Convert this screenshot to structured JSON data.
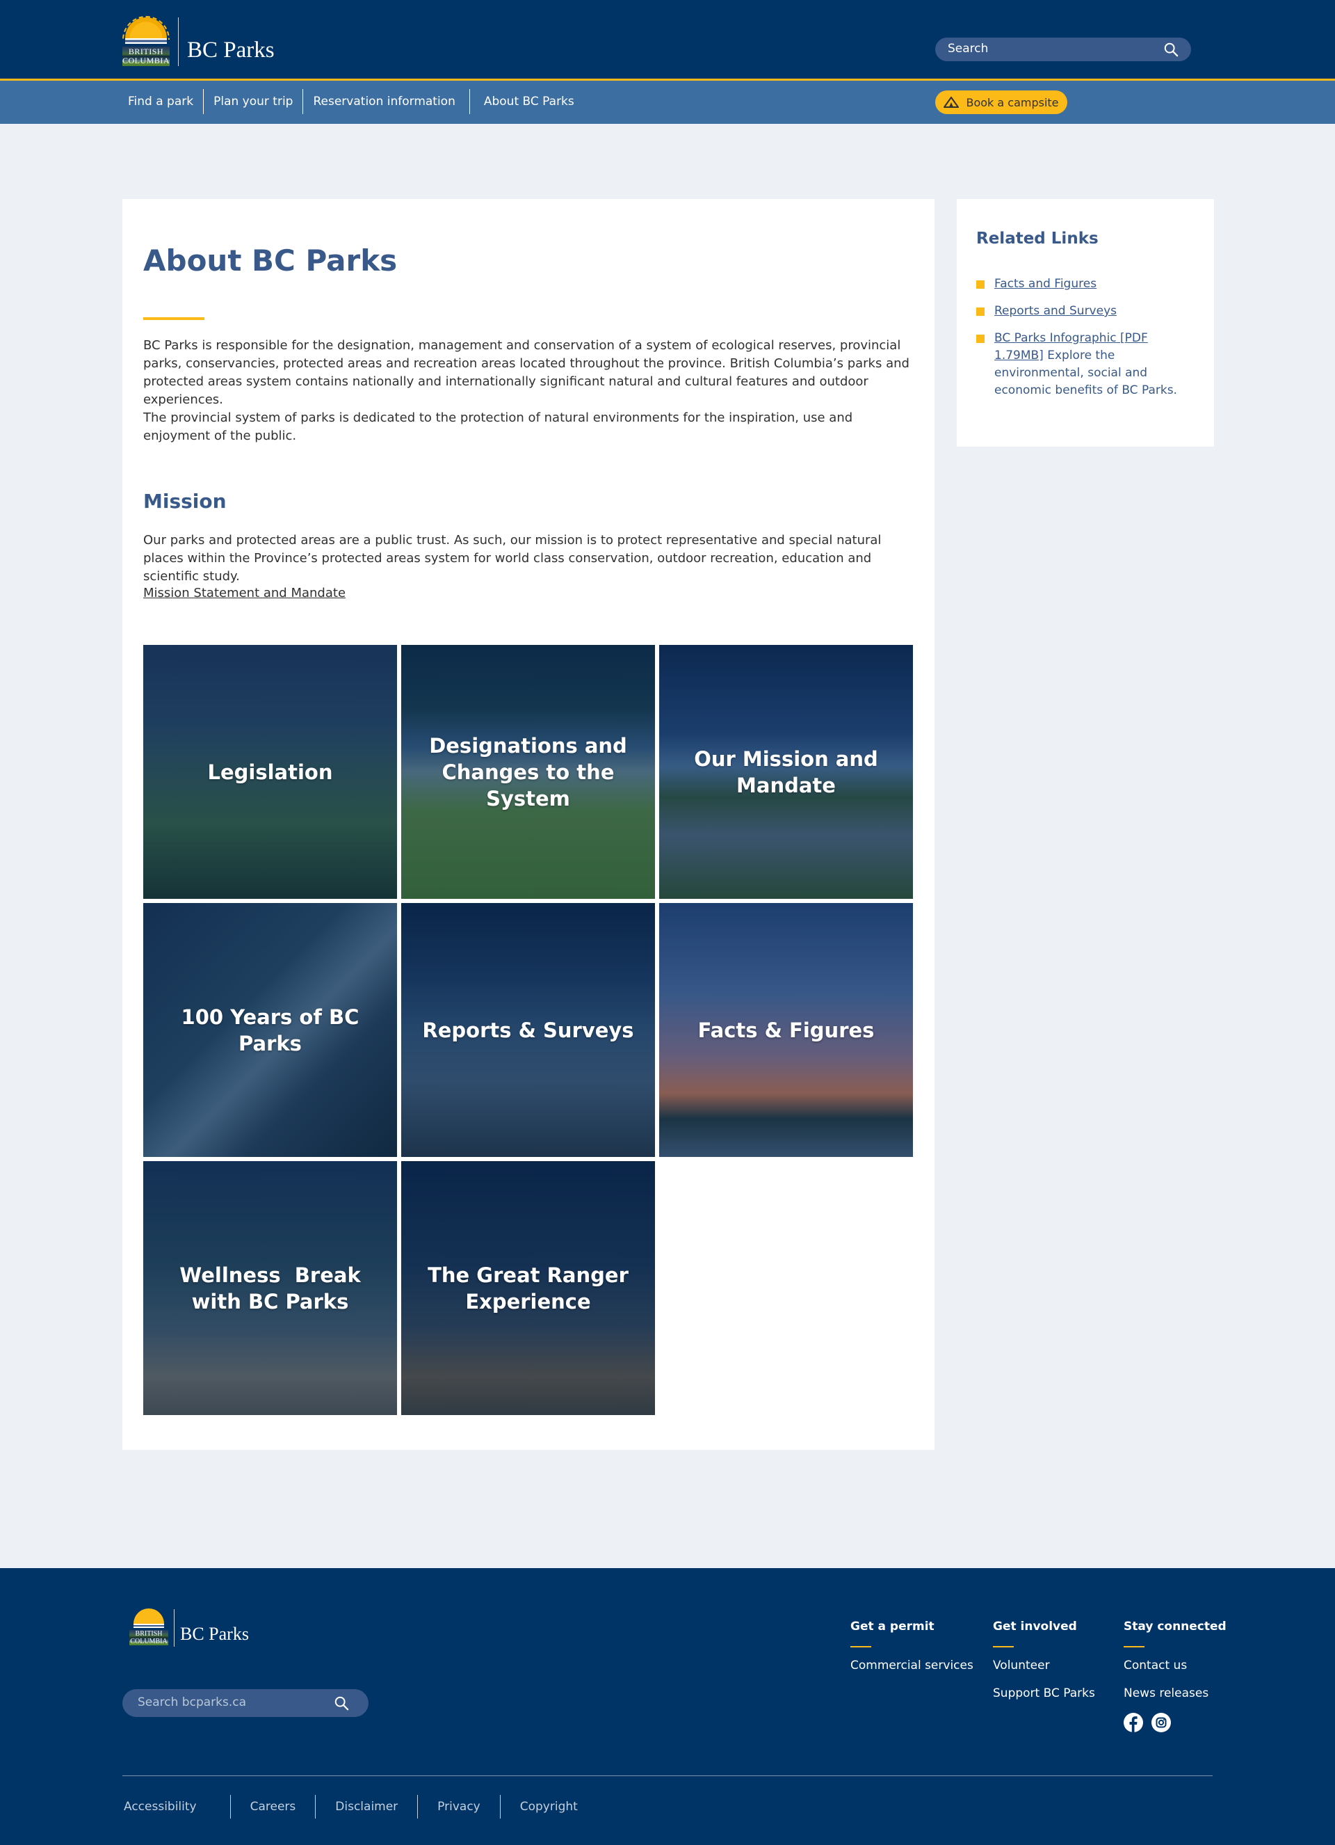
{
  "header": {
    "logo": {
      "line1": "BRITISH",
      "line2": "COLUMBIA",
      "name": "BC Parks"
    },
    "search_placeholder": "Search"
  },
  "nav": {
    "items": [
      "Find a park",
      "Plan your trip",
      "Reservation information",
      "About BC Parks"
    ],
    "book_label": "Book a campsite"
  },
  "main": {
    "title": "About BC Parks",
    "intro1": "BC Parks is responsible for the designation, management and conservation of a system of ecological reserves, provincial parks, conservancies, protected areas and recreation areas located throughout the province. British Columbia’s parks and protected areas system contains nationally and internationally significant natural and cultural features and outdoor experiences.",
    "intro2": "The provincial system of parks is dedicated to the protection of natural environments for the inspiration, use and enjoyment of the public.",
    "mission_heading": "Mission",
    "mission_text": "Our parks and protected areas are a public trust. As such, our mission is to protect representative and special natural places within the Province’s protected areas system for world class conservation, outdoor recreation, education and scientific study.",
    "mission_link": "Mission Statement and Mandate",
    "tiles": [
      "Legislation",
      "Designations and Changes to the System",
      "Our Mission and Mandate",
      "100 Years of BC Parks",
      "Reports & Surveys",
      "Facts & Figures",
      "Wellness  Break with BC Parks",
      "The Great Ranger Experience"
    ]
  },
  "related": {
    "title": "Related Links",
    "links": [
      {
        "link": "Facts and Figures",
        "text": ""
      },
      {
        "link": "Reports and Surveys",
        "text": ""
      },
      {
        "link": "BC Parks Infographic [PDF 1.79MB]",
        "text": " Explore the environmental, social and economic benefits of BC Parks."
      }
    ]
  },
  "footer": {
    "logo": {
      "line1": "BRITISH",
      "line2": "COLUMBIA",
      "name": "BC Parks"
    },
    "search_placeholder": "Search bcparks.ca",
    "columns": [
      {
        "heading": "Get a permit",
        "links": [
          "Commercial services"
        ]
      },
      {
        "heading": "Get involved",
        "links": [
          "Volunteer",
          "Support BC Parks"
        ]
      },
      {
        "heading": "Stay connected",
        "links": [
          "Contact us",
          "News releases"
        ]
      }
    ],
    "social_icons": [
      "facebook-icon",
      "instagram-icon"
    ],
    "bottom_links": [
      "Accessibility",
      "Careers",
      "Disclaimer",
      "Privacy",
      "Copyright"
    ]
  },
  "colors": {
    "header_bg": "#003366",
    "nav_bg": "#3c6ea1",
    "accent": "#fcba19",
    "heading": "#38598a",
    "page_bg": "#edf0f4"
  }
}
